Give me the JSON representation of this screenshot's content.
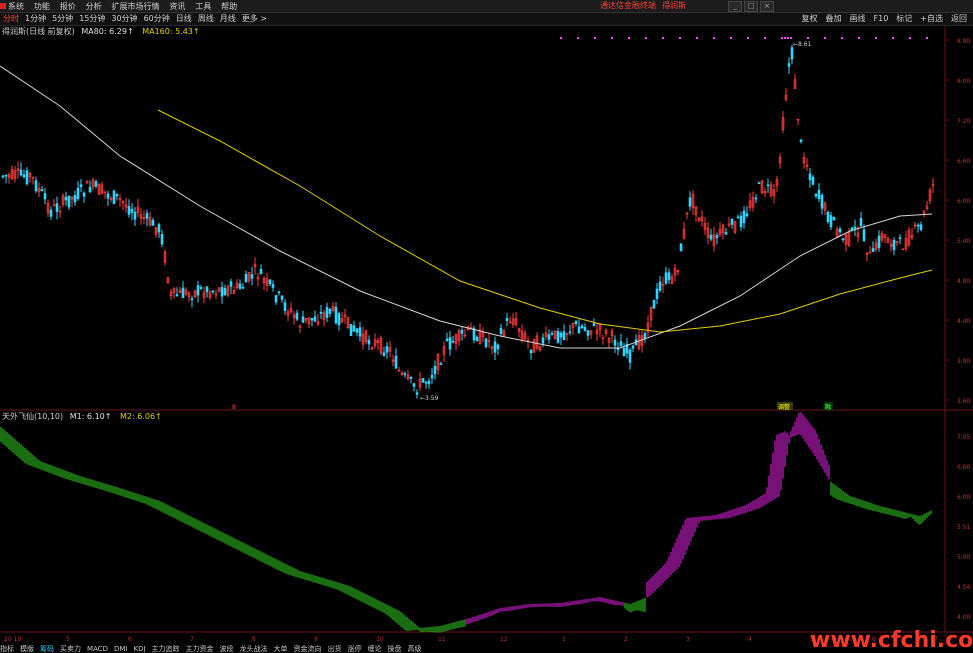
{
  "menu": [
    {
      "label": "系统"
    },
    {
      "label": "功能"
    },
    {
      "label": "报价"
    },
    {
      "label": "分析"
    },
    {
      "label": "扩展市场行情"
    },
    {
      "label": "资讯"
    },
    {
      "label": "工具"
    },
    {
      "label": "帮助"
    }
  ],
  "brand": {
    "center_text": "通达信金融终端",
    "stock_name": "得润斯"
  },
  "periods": [
    {
      "label": "分时",
      "active": true
    },
    {
      "label": "1分钟"
    },
    {
      "label": "5分钟"
    },
    {
      "label": "15分钟"
    },
    {
      "label": "30分钟"
    },
    {
      "label": "60分钟"
    },
    {
      "label": "日线"
    },
    {
      "label": "周线"
    },
    {
      "label": "月线"
    },
    {
      "label": "更多 >"
    }
  ],
  "right_tools": [
    {
      "label": "复权"
    },
    {
      "label": "叠加"
    },
    {
      "label": "画线"
    },
    {
      "label": "F10"
    },
    {
      "label": "标记"
    },
    {
      "label": "+自选"
    },
    {
      "label": "返回"
    }
  ],
  "main_legend": {
    "title": "得润斯(日线 前复权)",
    "ma80": "MA80: 6.29↑",
    "ma160": "MA160: 5.43↑"
  },
  "sub_legend": {
    "title": "天外飞仙(10,10)",
    "m1": "M1: 6.10↑",
    "m2": "M2: 6.06↑"
  },
  "annotations": {
    "low": "3.59",
    "high": "8.61",
    "event1": "8",
    "event2": "调整",
    "event3": "融"
  },
  "price_axis": [
    "8.80",
    "8.00",
    "7.20",
    "6.60",
    "6.00",
    "5.40",
    "4.80",
    "4.40",
    "3.90",
    "3.60"
  ],
  "sub_axis": [
    "7.05",
    "6.60",
    "6.00",
    "5.51",
    "5.00",
    "4.54",
    "4.00"
  ],
  "date_axis": [
    "20 10",
    "5",
    "6",
    "7",
    "8",
    "9",
    "10",
    "11",
    "12",
    "1",
    "2",
    "3",
    "4",
    "5",
    "6",
    "7"
  ],
  "tabs": [
    {
      "label": "指标",
      "active": false
    },
    {
      "label": "模版",
      "active": false
    },
    {
      "label": "筹码",
      "active": true
    },
    {
      "label": "买卖力",
      "active": false
    },
    {
      "label": "MACD",
      "active": false
    },
    {
      "label": "DMI",
      "active": false
    },
    {
      "label": "KDJ",
      "active": false
    },
    {
      "label": "主力追踪",
      "active": false
    },
    {
      "label": "主力资金",
      "active": false
    },
    {
      "label": "波段",
      "active": false
    },
    {
      "label": "龙头战法",
      "active": false
    },
    {
      "label": "大单",
      "active": false
    },
    {
      "label": "资金流向",
      "active": false
    },
    {
      "label": "出货",
      "active": false
    },
    {
      "label": "涨停",
      "active": false
    },
    {
      "label": "缠论",
      "active": false
    },
    {
      "label": "操盘",
      "active": false
    },
    {
      "label": "高级",
      "active": false
    }
  ],
  "colors": {
    "up": "#ff3b3b",
    "down": "#2fd6ff",
    "ma80": "#d8d8d8",
    "ma160": "#e0d000",
    "bar_green": "#33dd22",
    "bar_magenta": "#ee22ee"
  },
  "watermark": "www.cfchi.com"
}
